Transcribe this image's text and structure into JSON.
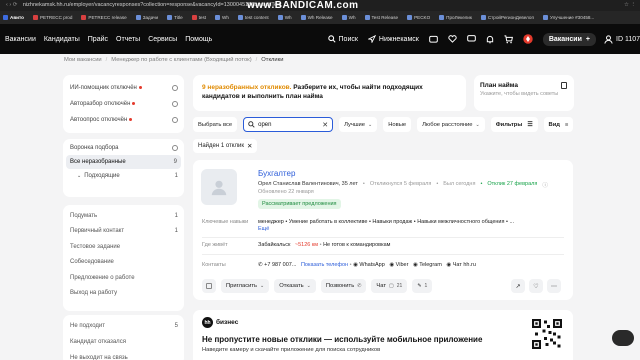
{
  "browser": {
    "url": "nizhnekamsk.hh.ru/employer/vacancyresponses?collection=response&vacancyId=130004518&searchText",
    "watermark": "www.BANDICAM.com",
    "bookmarks": [
      {
        "label": "Авито",
        "color": "#3d6bdf",
        "bold": true
      },
      {
        "label": "PETRECC prod",
        "color": "#d84040"
      },
      {
        "label": "PETRECC release",
        "color": "#d84040"
      },
      {
        "label": "Задачи",
        "color": "#6b8fd8"
      },
      {
        "label": "Title",
        "color": "#6b8fd8"
      },
      {
        "label": "test",
        "color": "#d84040"
      },
      {
        "label": "Wh",
        "color": "#6b8fd8"
      },
      {
        "label": "test content",
        "color": "#6b8fd8"
      },
      {
        "label": "Wh",
        "color": "#6b8fd8"
      },
      {
        "label": "Wh Release",
        "color": "#6b8fd8"
      },
      {
        "label": "Wh",
        "color": "#6b8fd8"
      },
      {
        "label": "Test Release",
        "color": "#6b8fd8"
      },
      {
        "label": "PECKO",
        "color": "#6b8fd8"
      },
      {
        "label": "ПроЛекелик",
        "color": "#6b8fd8"
      },
      {
        "label": "СтройРегионДевелоп",
        "color": "#6b8fd8"
      },
      {
        "label": "Улучшение #30458...",
        "color": "#6b8fd8"
      }
    ]
  },
  "header": {
    "nav": [
      "Вакансии",
      "Кандидаты",
      "Прайс",
      "Отчеты",
      "Сервисы",
      "Помощь"
    ],
    "search_label": "Поиск",
    "city_label": "Нижнекамск",
    "vacancies_button": "Вакансии",
    "id_label": "ID 1107"
  },
  "breadcrumb": [
    "Мои вакансии",
    "Менеджер по работе с клиентами (Входящий поток)",
    "Отклики"
  ],
  "sidebar": {
    "automation": [
      {
        "label": "ИИ-помощник отключён",
        "dot": true
      },
      {
        "label": "Авторазбор отключён",
        "dot": true
      },
      {
        "label": "Автоопрос отключён",
        "dot": true
      }
    ],
    "funnel_title": "Воронка подбора",
    "funnel": [
      {
        "label": "Все неразобранные",
        "count": "9",
        "active": true
      },
      {
        "label": "Подходящие",
        "count": "1",
        "sub": true
      }
    ],
    "stages": [
      {
        "label": "Подумать",
        "count": "1"
      },
      {
        "label": "Первичный контакт",
        "count": "1"
      },
      {
        "label": "Тестовое задание",
        "count": ""
      },
      {
        "label": "Собеседование",
        "count": ""
      },
      {
        "label": "Предложение о работе",
        "count": ""
      },
      {
        "label": "Выход на работу",
        "count": ""
      }
    ],
    "rejected": [
      {
        "label": "Не подходит",
        "count": "5"
      },
      {
        "label": "Кандидат отказался",
        "count": ""
      },
      {
        "label": "Не выходит на связь",
        "count": ""
      }
    ]
  },
  "banner": {
    "highlight": "9 неразобранных откликов.",
    "text": " Разберите их, чтобы найти подходящих кандидатов и выполнить план найма"
  },
  "plan": {
    "title": "План найма",
    "subtitle": "Укажите, чтобы видеть советы"
  },
  "filters": {
    "select_all": "Выбрать все",
    "search_value": "open",
    "best": "Лучшие",
    "new": "Новые",
    "distance": "Любое расстояние",
    "filters": "Фильтры",
    "view": "Вид"
  },
  "found": {
    "label": "Найден 1 отклик"
  },
  "response": {
    "title": "Бухгалтер",
    "name": "Орел Станислав Валентинович, 35 лет",
    "responded": "Откликнулся 5 февраля",
    "was_online": "Был сегодня",
    "response_date": "Отклик 27 февраля",
    "updated": "Обновлено 22 января",
    "tag": "Рассматривает предложения",
    "skills_label": "Ключевые навыки",
    "skills": "менеджер  •  Умение работать в коллективе  •  Навыки продаж  •  Навыки межличностного общения  •  ...",
    "more": "Ещё",
    "lives_label": "Где живёт",
    "city": "Забайкальск",
    "distance": "~5126 км",
    "relocate": "Не готов к командировкам",
    "contacts_label": "Контакты",
    "phone": "+7 987 007...",
    "show_phone": "Показать телефон",
    "whatsapp": "WhatsApp",
    "viber": "Viber",
    "telegram": "Telegram",
    "hh_chat": "Чат hh.ru",
    "actions": {
      "invite": "Пригласить",
      "reject": "Отказать",
      "call": "Позвонить",
      "chat": "Чат",
      "chat_count": "21",
      "comments_count": "1"
    }
  },
  "promo": {
    "brand": "бизнес",
    "title": "Не пропустите новые отклики — используйте мобильное приложение",
    "subtitle": "Наведите камеру и скачайте приложение для поиска сотрудников"
  },
  "colors": {
    "accent": "#2b5cd9",
    "warning": "#e08a00",
    "success": "#18a34a",
    "danger": "#e43a2c"
  }
}
